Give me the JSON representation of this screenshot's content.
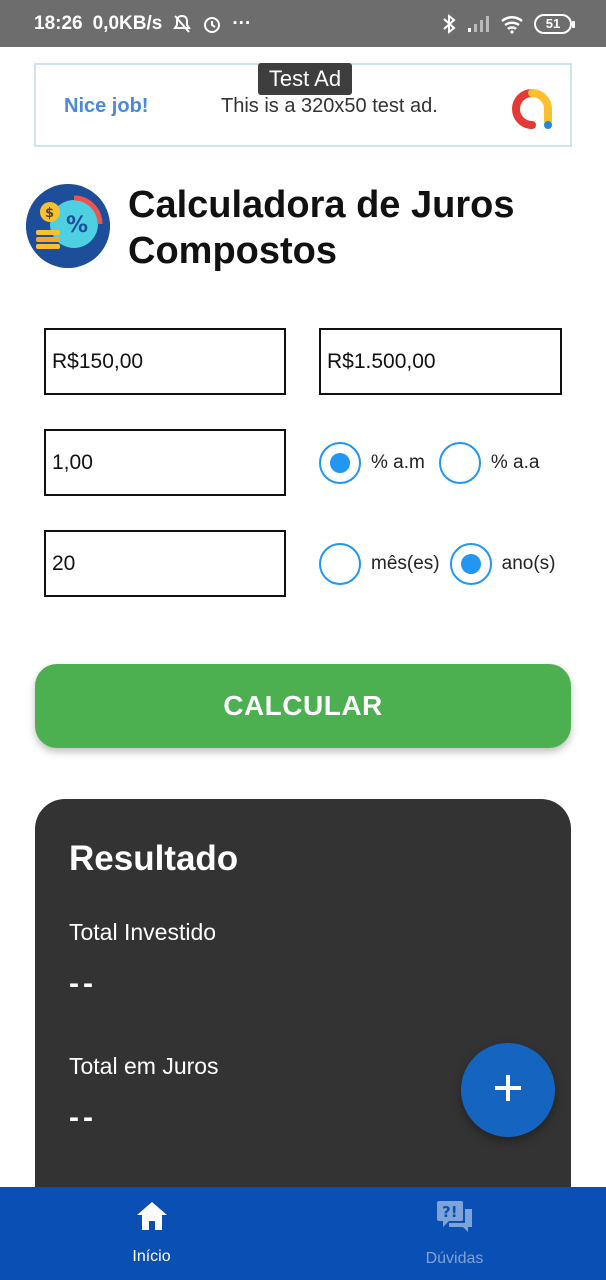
{
  "status_bar": {
    "time": "18:26",
    "speed": "0,0KB/s",
    "dots": "···",
    "battery": "51",
    "icons": [
      "mute-bell-icon",
      "alarm-icon",
      "bluetooth-icon",
      "signal-icon",
      "wifi-icon",
      "battery-icon"
    ]
  },
  "ad": {
    "tag": "Test Ad",
    "nice": "Nice job!",
    "text": "This is a 320x50 test ad."
  },
  "header": {
    "title": "Calculadora de Juros Compostos"
  },
  "form": {
    "monthly_value": "R$150,00",
    "initial_value": "R$1.500,00",
    "rate": "1,00",
    "rate_period": {
      "option_month": "% a.m",
      "option_year": "% a.a",
      "selected": "month"
    },
    "period": "20",
    "period_unit": {
      "option_month": "mês(es)",
      "option_year": "ano(s)",
      "selected": "year"
    }
  },
  "calculate_button": {
    "label": "CALCULAR",
    "color": "#4caf50"
  },
  "result": {
    "title": "Resultado",
    "total_invested_label": "Total Investido",
    "total_invested_value": "--",
    "total_interest_label": "Total em Juros",
    "total_interest_value": "--"
  },
  "fab": {
    "icon": "plus-icon"
  },
  "bottom_nav": {
    "items": [
      {
        "label": "Início",
        "icon": "home-icon",
        "active": true
      },
      {
        "label": "Dúvidas",
        "icon": "questions-chat-icon",
        "active": false
      }
    ],
    "color": "#0a4fb4"
  },
  "colors": {
    "accent_blue": "#2196f3",
    "card_dark": "#333333"
  }
}
